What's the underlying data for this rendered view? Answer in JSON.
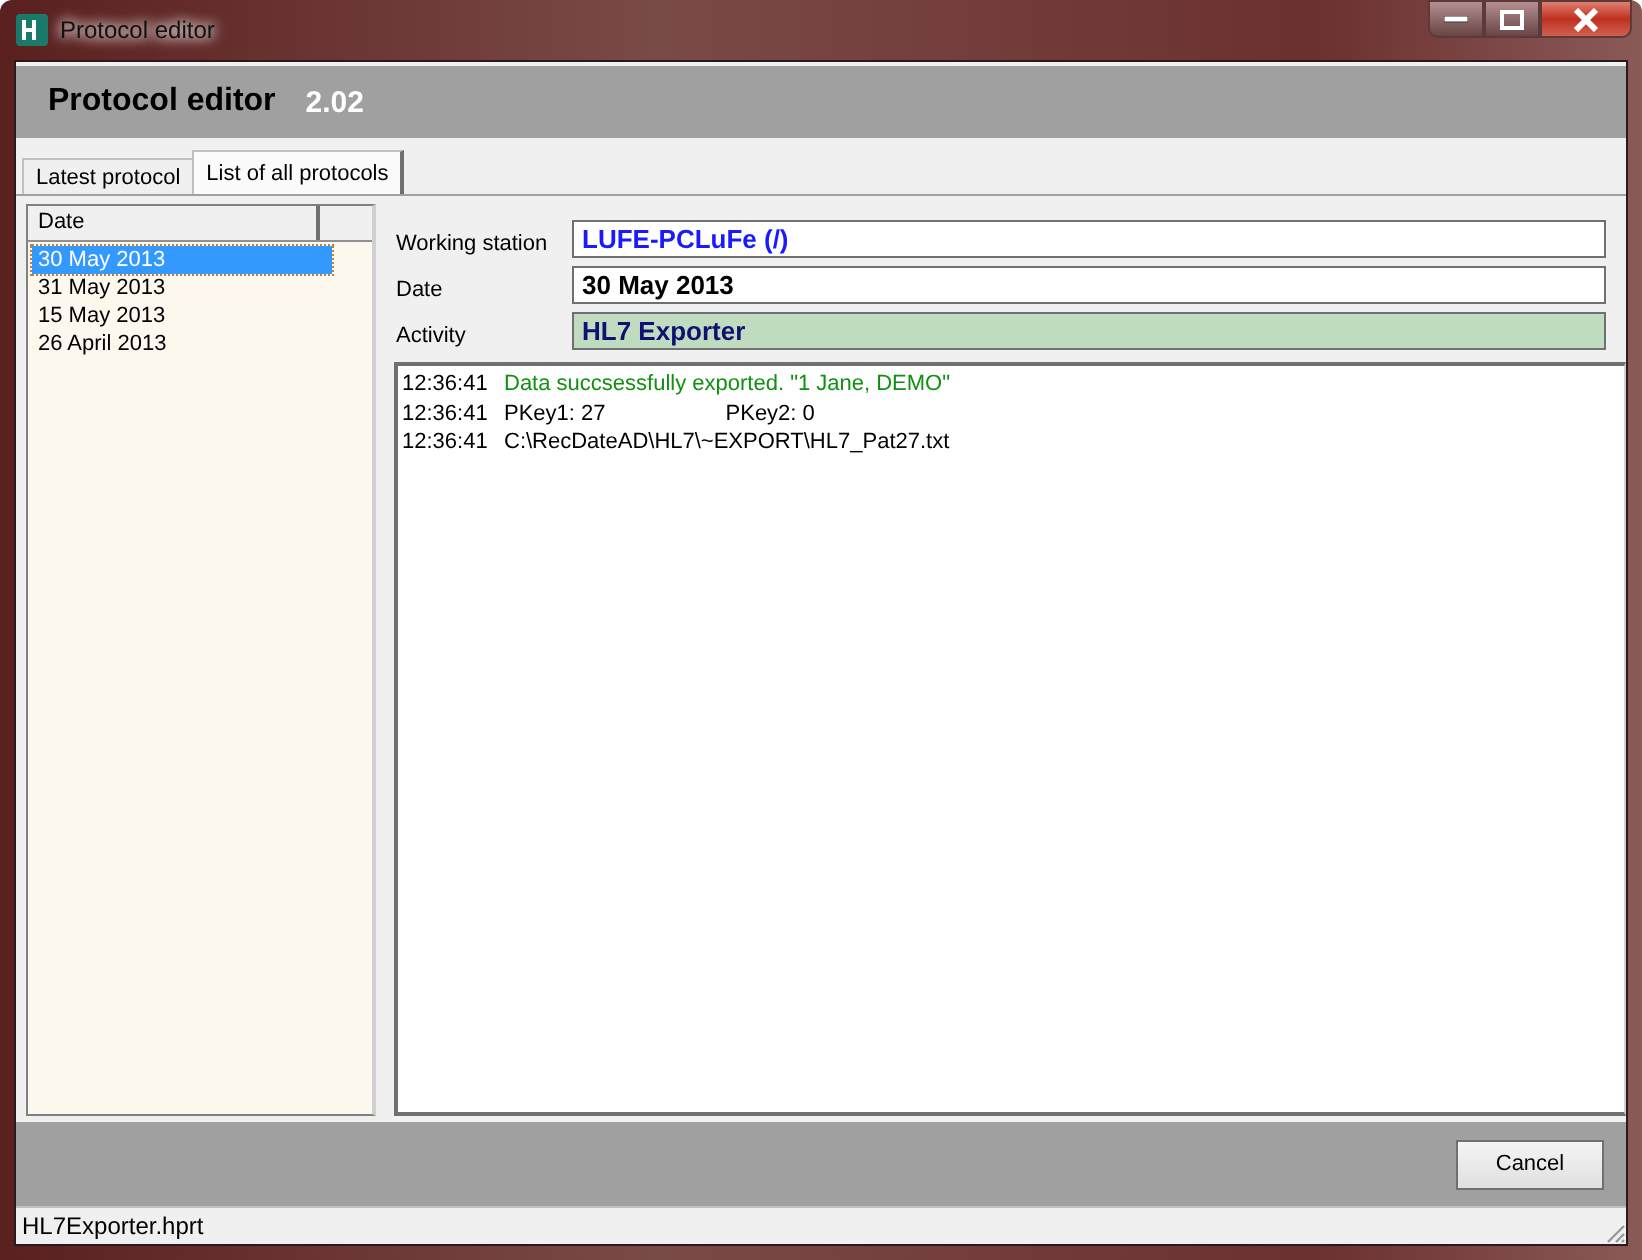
{
  "window": {
    "title": "Protocol editor"
  },
  "header": {
    "title": "Protocol editor",
    "version": "2.02"
  },
  "tabs": [
    {
      "label": "Latest protocol",
      "selected": false
    },
    {
      "label": "List of all protocols",
      "selected": true
    }
  ],
  "date_list": {
    "column": "Date",
    "items": [
      {
        "label": "30 May 2013",
        "selected": true
      },
      {
        "label": "31 May 2013",
        "selected": false
      },
      {
        "label": "15 May 2013",
        "selected": false
      },
      {
        "label": "26 April 2013",
        "selected": false
      }
    ]
  },
  "fields": [
    {
      "label": "Working station",
      "value": "LUFE-PCLuFe (/)",
      "kind": "station"
    },
    {
      "label": "Date",
      "value": "30 May 2013",
      "kind": "plain"
    },
    {
      "label": "Activity",
      "value": "HL7 Exporter",
      "kind": "activity"
    }
  ],
  "log": [
    {
      "time": "12:36:41",
      "kind": "success",
      "texts": [
        "Data succsessfully exported. \"1 Jane, DEMO\""
      ]
    },
    {
      "time": "12:36:41",
      "kind": "detail",
      "texts": [
        "PKey1: 27",
        "PKey2: 0"
      ]
    },
    {
      "time": "12:36:41",
      "kind": "detail",
      "texts": [
        "C:\\RecDateAD\\HL7\\~EXPORT\\HL7_Pat27.txt"
      ]
    }
  ],
  "buttons": [
    "Cancel"
  ],
  "status_bar": "HL7Exporter.hprt"
}
